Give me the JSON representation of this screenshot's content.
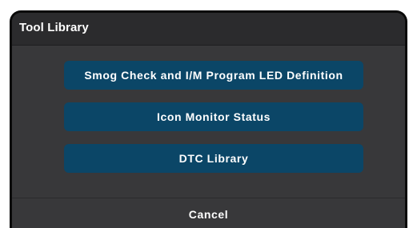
{
  "dialog": {
    "title": "Tool Library",
    "options": [
      {
        "label": "Smog Check and I/M Program LED Definition"
      },
      {
        "label": "Icon Monitor Status"
      },
      {
        "label": "DTC Library"
      }
    ],
    "cancel_label": "Cancel"
  },
  "colors": {
    "dialog_background": "#38383a",
    "header_background": "#2b2b2d",
    "button_background": "#0b4667",
    "text": "#ffffff",
    "border": "#0a0a0a"
  }
}
